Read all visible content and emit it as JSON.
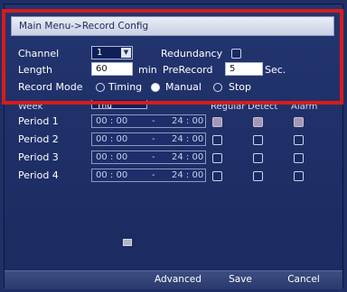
{
  "title": "Main Menu->Record Config",
  "config": {
    "channel_label": "Channel",
    "channel_value": "1",
    "redundancy_label": "Redundancy",
    "length_label": "Length",
    "length_value": "60",
    "length_unit": "min",
    "prerecord_label": "PreRecord",
    "prerecord_value": "5",
    "prerecord_unit": "Sec.",
    "record_mode_label": "Record Mode",
    "modes": [
      "Timing",
      "Manual",
      "Stop"
    ],
    "selected_mode": "Manual"
  },
  "schedule": {
    "week_label": "Week",
    "week_value": "Thu",
    "column_regular": "Regular",
    "column_detect": "Detect",
    "column_alarm": "Alarm",
    "periods": [
      {
        "label": "Period 1",
        "start": "00 : 00",
        "sep": "-",
        "end": "24 : 00",
        "regular": true,
        "detect": true,
        "alarm": true
      },
      {
        "label": "Period 2",
        "start": "00 : 00",
        "sep": "-",
        "end": "24 : 00",
        "regular": false,
        "detect": false,
        "alarm": false
      },
      {
        "label": "Period 3",
        "start": "00 : 00",
        "sep": "-",
        "end": "24 : 00",
        "regular": false,
        "detect": false,
        "alarm": false
      },
      {
        "label": "Period 4",
        "start": "00 : 00",
        "sep": "-",
        "end": "24 : 00",
        "regular": false,
        "detect": false,
        "alarm": false
      }
    ]
  },
  "buttons": {
    "advanced": "Advanced",
    "save": "Save",
    "cancel": "Cancel"
  },
  "colors": {
    "background": "#1f2f67",
    "highlight": "#d81b1b",
    "checked": "#a596b6"
  }
}
